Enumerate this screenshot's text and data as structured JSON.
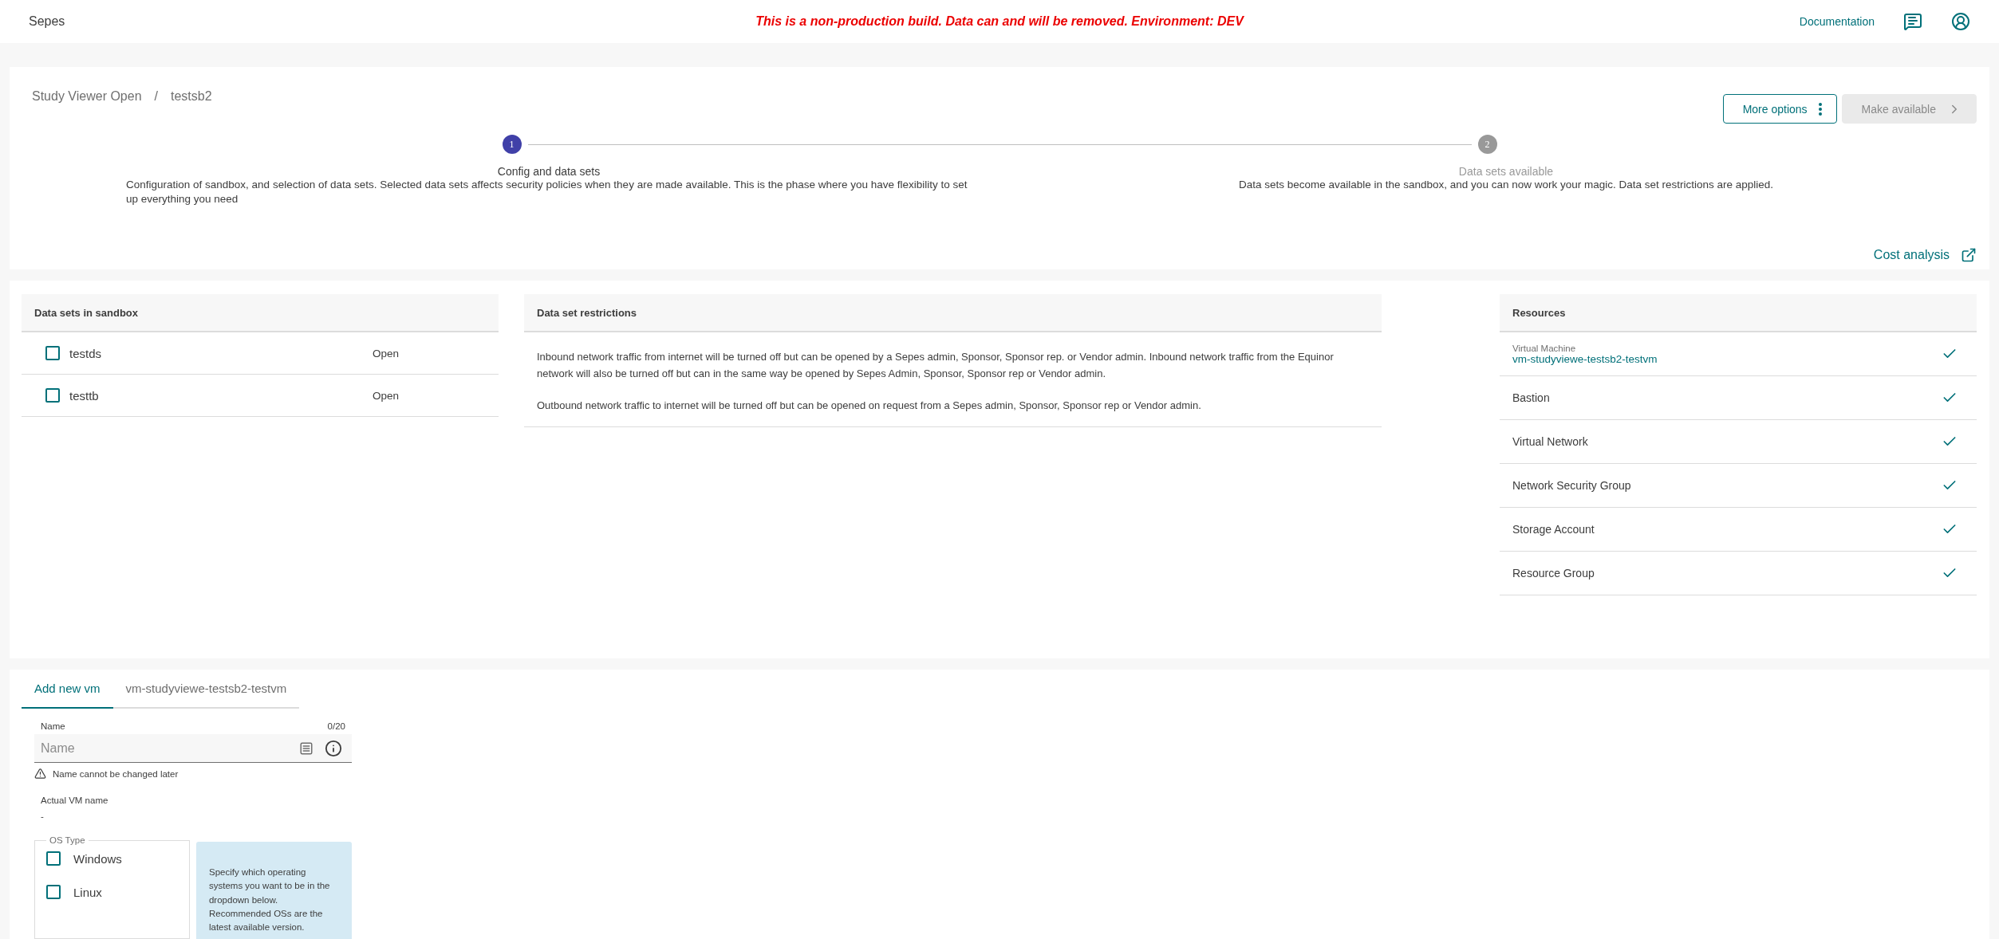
{
  "app_bar": {
    "title": "Sepes",
    "banner": "This is a non-production build. Data can and will be removed. Environment: DEV",
    "links": [
      {
        "label": "Documentation"
      }
    ]
  },
  "breadcrumb": [
    "Study Viewer Open",
    "/",
    "testsb2"
  ],
  "actions": [
    {
      "label": "More options",
      "kind": "menu",
      "disabled": false
    },
    {
      "label": "Make available",
      "kind": "next",
      "disabled": true
    }
  ],
  "steps": [
    {
      "number": "1",
      "title": "Config and data sets",
      "description": "Configuration of sandbox, and selection of data sets. Selected data sets affects security policies when they are made available. This is the phase where you have flexibility to set up everything you need",
      "selected": true
    },
    {
      "number": "2",
      "title": "Data sets available",
      "description": "Data sets become available in the sandbox, and you can now work your magic. Data set restrictions are applied.",
      "selected": false
    }
  ],
  "cost_link": "Cost analysis",
  "datasets": {
    "title": "Data sets in sandbox",
    "rows": [
      {
        "name": "testds",
        "status": "Open",
        "checked": false
      },
      {
        "name": "testtb",
        "status": "Open",
        "checked": false
      }
    ]
  },
  "restrictions": {
    "title": "Data set restrictions",
    "paragraphs": [
      "Inbound network traffic from internet will be turned off but can be opened by a Sepes admin, Sponsor, Sponsor rep. or Vendor admin. Inbound network traffic from the Equinor network will also be turned off but can in the same way be opened by Sepes Admin, Sponsor, Sponsor rep or Vendor admin.",
      "Outbound network traffic to internet will be turned off but can be opened on request from a Sepes admin, Sponsor, Sponsor rep or Vendor admin."
    ]
  },
  "resources": {
    "title": "Resources",
    "rows": [
      {
        "label": "Virtual Machine",
        "value": "vm-studyviewe-testsb2-testvm",
        "done": true
      },
      {
        "label": "Bastion",
        "done": true
      },
      {
        "label": "Virtual Network",
        "done": true
      },
      {
        "label": "Network Security Group",
        "done": true
      },
      {
        "label": "Storage Account",
        "done": true
      },
      {
        "label": "Resource Group",
        "done": true
      }
    ]
  },
  "vm_tabs": [
    {
      "label": "Add new vm",
      "selected": true
    },
    {
      "label": "vm-studyviewe-testsb2-testvm",
      "selected": false
    }
  ],
  "vm_form": {
    "name_label": "Name",
    "counter": "0/20",
    "placeholder": "Name",
    "warning": "Name cannot be changed later",
    "actual_label": "Actual VM name",
    "actual_value": "-",
    "os_legend": "OS Type",
    "os_options": [
      {
        "label": "Windows",
        "checked": false
      },
      {
        "label": "Linux",
        "checked": false
      }
    ],
    "info": "Specify which operating systems you want to be in the dropdown below. Recommended OSs are the latest available version."
  }
}
